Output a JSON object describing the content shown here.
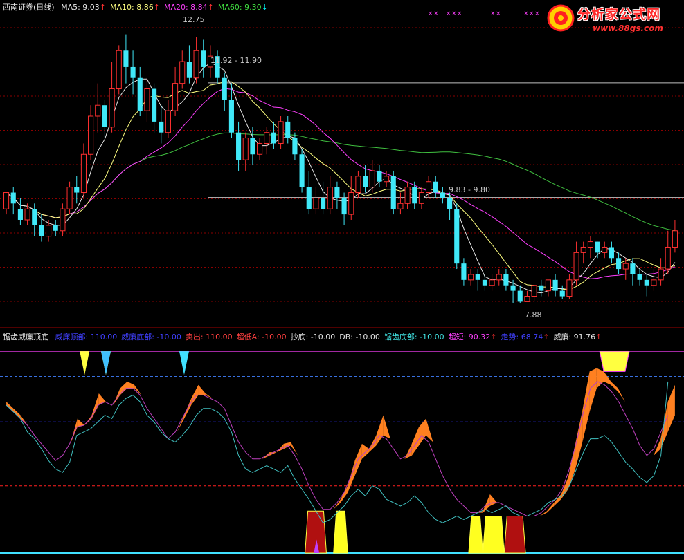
{
  "header": {
    "title": "西南证券(日线)",
    "ma_items": [
      {
        "label": "MA5: 9.03",
        "arrow": "↑",
        "color": "#e8e8e8",
        "arrow_color": "#ff3030"
      },
      {
        "label": "MA10: 8.86",
        "arrow": "↑",
        "color": "#ffff80",
        "arrow_color": "#ff3030"
      },
      {
        "label": "MA20: 8.84",
        "arrow": "↑",
        "color": "#ff40ff",
        "arrow_color": "#ff3030"
      },
      {
        "label": "MA60: 9.30",
        "arrow": "↓",
        "color": "#40e040",
        "arrow_color": "#00ffff"
      }
    ]
  },
  "indicator_header": {
    "name": "锯齿威廉顶底",
    "items": [
      {
        "label": "威廉顶部: 110.00",
        "color": "#4040ff",
        "arrow": ""
      },
      {
        "label": "威廉底部: -10.00",
        "color": "#4040ff",
        "arrow": ""
      },
      {
        "label": "卖出: 110.00",
        "color": "#ff4040",
        "arrow": ""
      },
      {
        "label": "超低A: -10.00",
        "color": "#ff4040",
        "arrow": ""
      },
      {
        "label": "抄底: -10.00",
        "color": "#e0e0e0",
        "arrow": ""
      },
      {
        "label": "DB: -10.00",
        "color": "#e0e0e0",
        "arrow": ""
      },
      {
        "label": "锯齿底部: -10.00",
        "color": "#40e0e0",
        "arrow": ""
      },
      {
        "label": "超短: 90.32",
        "color": "#ff40ff",
        "arrow": "↑"
      },
      {
        "label": "走势: 68.74",
        "color": "#4040ff",
        "arrow": "↑"
      },
      {
        "label": "威廉: 91.76",
        "color": "#e0e0e0",
        "arrow": "↑"
      }
    ]
  },
  "logo": {
    "brand": "分析家公式网",
    "url": "www.88gs.com"
  },
  "price_annotations": {
    "high": "12.75",
    "box1": "11.92 - 11.90",
    "box2": "9.83 - 9.80",
    "low": "7.88"
  },
  "colors": {
    "up": "#ff3030",
    "down": "#40e8f8",
    "ma5": "#e8e8e8",
    "ma10": "#ffff80",
    "ma20": "#ff40ff",
    "ma60": "#40c040",
    "grid": "#8b0000",
    "fill": "#ff8020",
    "cyan_line": "#40c0c0",
    "magenta_line": "#c040c0"
  },
  "chart_data": [
    {
      "type": "candlestick",
      "title": "西南证券(日线)",
      "ylim": [
        7.5,
        13.2
      ],
      "y_guides": [
        11.91,
        9.81
      ],
      "candles": [
        [
          9.6,
          9.9,
          9.5,
          9.9
        ],
        [
          9.9,
          9.7,
          9.5,
          10.0
        ],
        [
          9.6,
          9.4,
          9.3,
          9.8
        ],
        [
          9.4,
          9.6,
          9.3,
          9.7
        ],
        [
          9.6,
          9.3,
          9.1,
          9.7
        ],
        [
          9.3,
          9.1,
          9.0,
          9.5
        ],
        [
          9.1,
          9.3,
          9.0,
          9.4
        ],
        [
          9.3,
          9.2,
          9.1,
          9.4
        ],
        [
          9.2,
          9.6,
          9.1,
          9.7
        ],
        [
          9.6,
          10.0,
          9.5,
          10.1
        ],
        [
          10.0,
          9.9,
          9.7,
          10.2
        ],
        [
          9.9,
          10.6,
          9.8,
          10.8
        ],
        [
          10.6,
          11.3,
          10.5,
          11.5
        ],
        [
          11.3,
          11.5,
          11.0,
          11.9
        ],
        [
          11.5,
          11.1,
          10.9,
          11.6
        ],
        [
          11.1,
          11.8,
          11.0,
          12.3
        ],
        [
          11.8,
          12.5,
          11.7,
          12.6
        ],
        [
          12.5,
          12.2,
          11.9,
          12.8
        ],
        [
          12.2,
          12.0,
          11.7,
          12.5
        ],
        [
          12.0,
          11.4,
          11.3,
          12.2
        ],
        [
          11.4,
          11.8,
          11.2,
          12.0
        ],
        [
          11.8,
          11.2,
          11.0,
          11.9
        ],
        [
          11.2,
          11.0,
          10.8,
          11.5
        ],
        [
          11.0,
          11.4,
          10.9,
          11.6
        ],
        [
          11.4,
          11.9,
          11.3,
          12.2
        ],
        [
          11.9,
          12.3,
          11.8,
          12.5
        ],
        [
          12.3,
          12.0,
          11.9,
          12.6
        ],
        [
          12.0,
          12.5,
          11.9,
          12.75
        ],
        [
          12.5,
          12.2,
          12.0,
          12.7
        ],
        [
          12.2,
          12.4,
          12.0,
          12.6
        ],
        [
          12.4,
          12.0,
          11.9,
          12.5
        ],
        [
          12.0,
          11.6,
          11.4,
          12.1
        ],
        [
          11.6,
          11.0,
          10.9,
          11.9
        ],
        [
          11.0,
          10.5,
          10.3,
          11.2
        ],
        [
          10.5,
          10.9,
          10.3,
          11.0
        ],
        [
          10.9,
          10.6,
          10.4,
          11.1
        ],
        [
          10.6,
          10.8,
          10.5,
          10.9
        ],
        [
          10.8,
          11.0,
          10.6,
          11.1
        ],
        [
          11.0,
          10.8,
          10.7,
          11.2
        ],
        [
          10.8,
          11.2,
          10.7,
          11.3
        ],
        [
          11.2,
          10.9,
          10.8,
          11.3
        ],
        [
          10.9,
          10.6,
          10.5,
          11.0
        ],
        [
          10.6,
          10.0,
          9.9,
          10.7
        ],
        [
          10.0,
          9.6,
          9.5,
          10.3
        ],
        [
          9.6,
          9.8,
          9.5,
          10.0
        ],
        [
          9.8,
          9.6,
          9.5,
          10.1
        ],
        [
          9.6,
          10.0,
          9.5,
          10.2
        ],
        [
          10.0,
          9.8,
          9.6,
          10.1
        ],
        [
          9.8,
          9.5,
          9.3,
          9.9
        ],
        [
          9.5,
          9.9,
          9.4,
          10.2
        ],
        [
          9.9,
          10.2,
          9.8,
          10.3
        ],
        [
          10.2,
          10.0,
          9.9,
          10.4
        ],
        [
          10.0,
          10.3,
          9.9,
          10.5
        ],
        [
          10.3,
          10.1,
          10.0,
          10.4
        ],
        [
          10.1,
          10.2,
          10.0,
          10.3
        ],
        [
          10.2,
          9.6,
          9.5,
          10.3
        ],
        [
          9.6,
          9.7,
          9.5,
          9.9
        ],
        [
          9.7,
          10.0,
          9.6,
          10.1
        ],
        [
          10.0,
          9.7,
          9.6,
          10.1
        ],
        [
          9.7,
          9.9,
          9.6,
          10.0
        ],
        [
          9.9,
          10.1,
          9.8,
          10.2
        ],
        [
          10.1,
          9.9,
          9.8,
          10.2
        ],
        [
          9.9,
          9.8,
          9.7,
          10.0
        ],
        [
          9.8,
          9.6,
          9.4,
          9.9
        ],
        [
          9.6,
          8.6,
          8.5,
          9.7
        ],
        [
          8.6,
          8.3,
          8.2,
          8.7
        ],
        [
          8.3,
          8.4,
          8.2,
          8.5
        ],
        [
          8.4,
          8.3,
          8.1,
          8.5
        ],
        [
          8.3,
          8.2,
          8.1,
          8.4
        ],
        [
          8.2,
          8.3,
          8.1,
          8.4
        ],
        [
          8.3,
          8.4,
          8.2,
          8.5
        ],
        [
          8.4,
          8.2,
          8.1,
          8.5
        ],
        [
          8.2,
          8.1,
          7.88,
          8.3
        ],
        [
          8.1,
          7.9,
          7.88,
          8.2
        ],
        [
          7.9,
          8.0,
          7.9,
          8.1
        ],
        [
          8.0,
          8.2,
          7.9,
          8.2
        ],
        [
          8.2,
          8.1,
          8.0,
          8.3
        ],
        [
          8.1,
          8.3,
          8.0,
          8.3
        ],
        [
          8.3,
          8.1,
          8.0,
          8.4
        ],
        [
          8.1,
          8.0,
          7.95,
          8.2
        ],
        [
          8.0,
          8.3,
          7.95,
          8.4
        ],
        [
          8.3,
          8.8,
          8.2,
          9.0
        ],
        [
          8.8,
          8.9,
          8.6,
          9.0
        ],
        [
          8.9,
          9.0,
          8.7,
          9.1
        ],
        [
          9.0,
          8.8,
          8.7,
          9.0
        ],
        [
          8.8,
          8.9,
          8.7,
          9.0
        ],
        [
          8.9,
          8.7,
          8.6,
          9.0
        ],
        [
          8.7,
          8.5,
          8.4,
          8.8
        ],
        [
          8.5,
          8.6,
          8.3,
          8.7
        ],
        [
          8.6,
          8.4,
          8.2,
          8.7
        ],
        [
          8.4,
          8.3,
          8.2,
          8.5
        ],
        [
          8.3,
          8.2,
          8.0,
          8.4
        ],
        [
          8.2,
          8.3,
          8.1,
          8.5
        ],
        [
          8.3,
          8.5,
          8.2,
          8.7
        ],
        [
          8.5,
          8.9,
          8.4,
          9.2
        ],
        [
          8.9,
          9.2,
          8.8,
          9.4
        ]
      ]
    },
    {
      "type": "area",
      "title": "锯齿威廉顶底",
      "ylim": [
        -10,
        115
      ],
      "y_guides": [
        95,
        68,
        30
      ],
      "series": [
        {
          "name": "威廉",
          "values": [
            80,
            76,
            72,
            62,
            55,
            40,
            35,
            20,
            30,
            45,
            70,
            65,
            72,
            85,
            80,
            76,
            88,
            92,
            90,
            78,
            65,
            62,
            55,
            50,
            60,
            72,
            82,
            90,
            85,
            82,
            80,
            75,
            55,
            42,
            40,
            35,
            45,
            50,
            48,
            55,
            56,
            38,
            25,
            12,
            8,
            5,
            15,
            22,
            30,
            45,
            55,
            52,
            60,
            72,
            55,
            40,
            35,
            55,
            65,
            70,
            45,
            32,
            18,
            15,
            10,
            12,
            5,
            15,
            25,
            20,
            18,
            15,
            12,
            10,
            10,
            12,
            15,
            20,
            25,
            35,
            55,
            75,
            98,
            100,
            98,
            92,
            88,
            80,
            72,
            62,
            48,
            42,
            58,
            80,
            90
          ]
        },
        {
          "name": "超短",
          "values": [
            78,
            74,
            70,
            66,
            60,
            55,
            50,
            45,
            48,
            55,
            65,
            66,
            70,
            78,
            80,
            78,
            84,
            88,
            88,
            84,
            76,
            70,
            64,
            58,
            62,
            70,
            78,
            84,
            84,
            82,
            80,
            76,
            66,
            56,
            50,
            46,
            46,
            48,
            50,
            52,
            54,
            48,
            40,
            30,
            22,
            16,
            16,
            20,
            26,
            36,
            46,
            50,
            54,
            60,
            58,
            52,
            46,
            48,
            54,
            60,
            56,
            46,
            36,
            28,
            22,
            18,
            14,
            14,
            18,
            20,
            20,
            18,
            16,
            14,
            12,
            12,
            14,
            18,
            22,
            28,
            40,
            56,
            74,
            88,
            92,
            90,
            86,
            80,
            72,
            64,
            54,
            48,
            52,
            62,
            72
          ]
        },
        {
          "name": "走势",
          "values": [
            78,
            74,
            70,
            62,
            58,
            52,
            45,
            40,
            38,
            44,
            60,
            62,
            64,
            68,
            72,
            70,
            78,
            82,
            84,
            80,
            72,
            68,
            62,
            58,
            56,
            60,
            65,
            72,
            76,
            76,
            74,
            70,
            62,
            48,
            40,
            38,
            40,
            42,
            40,
            38,
            42,
            34,
            28,
            22,
            15,
            8,
            10,
            14,
            18,
            24,
            28,
            24,
            30,
            28,
            22,
            20,
            18,
            20,
            24,
            20,
            14,
            10,
            8,
            10,
            12,
            10,
            12,
            14,
            16,
            14,
            16,
            18,
            14,
            12,
            12,
            14,
            16,
            20,
            22,
            24,
            30,
            40,
            50,
            58,
            58,
            60,
            56,
            50,
            44,
            40,
            35,
            32,
            36,
            48,
            92
          ]
        }
      ]
    }
  ]
}
